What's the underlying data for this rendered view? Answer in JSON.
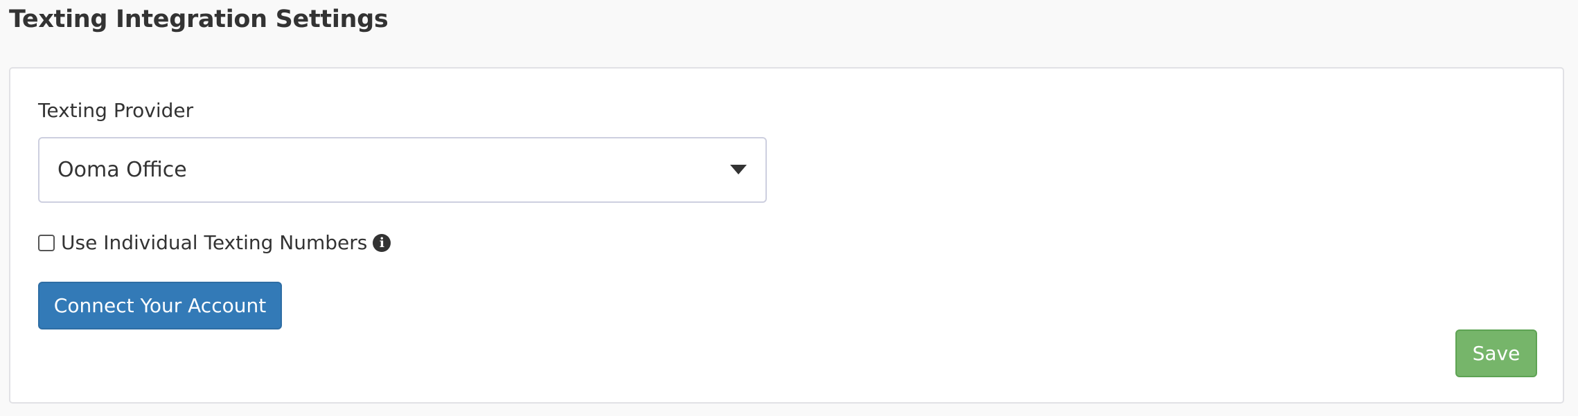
{
  "page": {
    "title": "Texting Integration Settings"
  },
  "form": {
    "provider_label": "Texting Provider",
    "provider_selected": "Ooma Office",
    "individual_numbers_label": "Use Individual Texting Numbers",
    "individual_numbers_checked": false,
    "info_icon": "info-circle-icon",
    "info_glyph": "i"
  },
  "actions": {
    "connect_label": "Connect Your Account",
    "save_label": "Save"
  },
  "colors": {
    "primary": "#337ab7",
    "success": "#76b56a",
    "text": "#333333",
    "background": "#f9f9f9"
  }
}
